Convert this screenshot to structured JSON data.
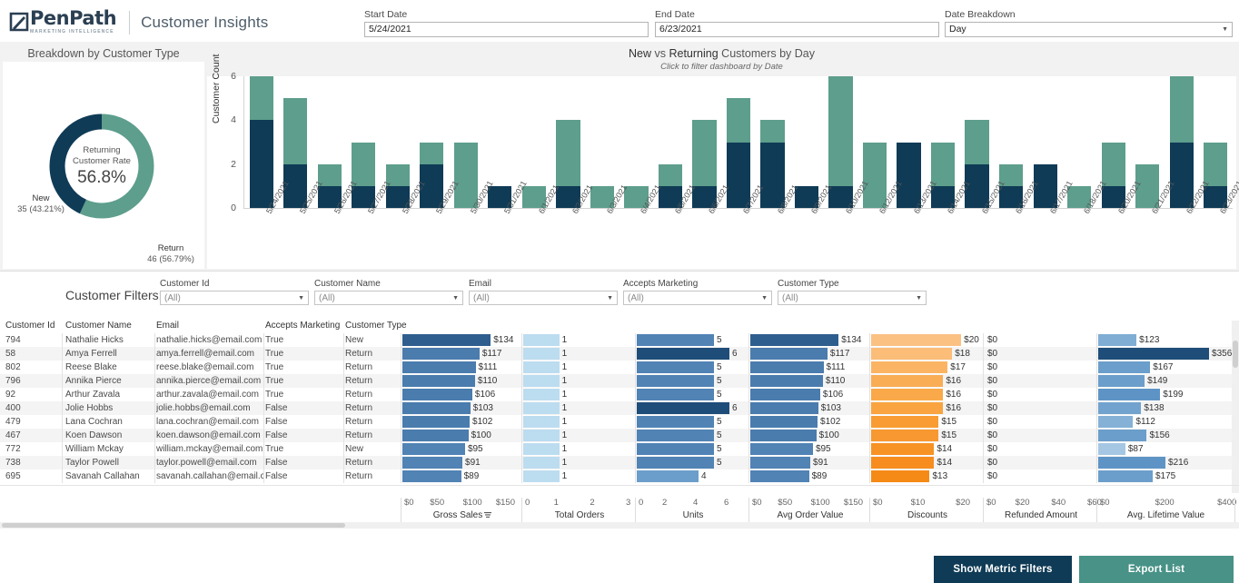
{
  "header": {
    "logo_name": "PenPath",
    "logo_sub": "MARKETING INTELLIGENCE",
    "app_title": "Customer Insights",
    "start_date": {
      "label": "Start Date",
      "value": "5/24/2021"
    },
    "end_date": {
      "label": "End Date",
      "value": "6/23/2021"
    },
    "date_breakdown": {
      "label": "Date Breakdown",
      "value": "Day"
    }
  },
  "donut_panel": {
    "title": "Breakdown by Customer Type",
    "center_line1": "Returning",
    "center_line2": "Customer Rate",
    "center_value": "56.8%",
    "new_label": "New",
    "new_value": "35 (43.21%)",
    "return_label": "Return",
    "return_value": "46 (56.79%)"
  },
  "bar_panel": {
    "title_a": "New",
    "title_b": "vs",
    "title_c": "Returning",
    "title_d": "Customers by Day",
    "subtitle": "Click to filter dashboard by Date"
  },
  "chart_data": {
    "type": "bar",
    "title": "New vs Returning Customers by Day",
    "subtitle": "Click to filter dashboard by Date",
    "xlabel": "",
    "ylabel": "Customer Count",
    "ylim": [
      0,
      6
    ],
    "yticks": [
      0,
      2,
      4,
      6
    ],
    "stacked": true,
    "grid": false,
    "legend_position": "none",
    "categories": [
      "5/24/2021",
      "5/25/2021",
      "5/26/2021",
      "5/27/2021",
      "5/28/2021",
      "5/29/2021",
      "5/30/2021",
      "5/31/2021",
      "6/1/2021",
      "6/2/2021",
      "6/3/2021",
      "6/4/2021",
      "6/5/2021",
      "6/6/2021",
      "6/7/2021",
      "6/8/2021",
      "6/9/2021",
      "6/10/2021",
      "6/12/2021",
      "6/13/2021",
      "6/14/2021",
      "6/15/2021",
      "6/16/2021",
      "6/17/2021",
      "6/18/2021",
      "6/20/2021",
      "6/21/2021",
      "6/22/2021",
      "6/23/2021"
    ],
    "series": [
      {
        "name": "New",
        "color": "#0f3b56",
        "values": [
          4,
          2,
          1,
          1,
          1,
          2,
          0,
          1,
          0,
          1,
          0,
          0,
          1,
          1,
          3,
          3,
          1,
          1,
          0,
          3,
          1,
          2,
          1,
          2,
          0,
          1,
          0,
          3,
          1
        ]
      },
      {
        "name": "Return",
        "color": "#5d9e8c",
        "values": [
          2,
          3,
          1,
          2,
          1,
          1,
          3,
          0,
          1,
          3,
          1,
          1,
          1,
          3,
          2,
          1,
          0,
          5,
          3,
          0,
          2,
          2,
          1,
          0,
          1,
          2,
          2,
          3,
          2
        ]
      }
    ]
  },
  "filters": {
    "title": "Customer Filters:",
    "items": [
      {
        "label": "Customer Id",
        "value": "(All)"
      },
      {
        "label": "Customer Name",
        "value": "(All)"
      },
      {
        "label": "Email",
        "value": "(All)"
      },
      {
        "label": "Accepts Marketing",
        "value": "(All)"
      },
      {
        "label": "Customer Type",
        "value": "(All)"
      }
    ],
    "show_metric_filters": "Show Metric Filters",
    "export_list": "Export List"
  },
  "table": {
    "text_headers": [
      "Customer Id",
      "Customer Name",
      "Email",
      "Accepts Marketing",
      "Customer Type"
    ],
    "metric_axes": [
      {
        "name": "Gross Sales",
        "ticks": [
          "$0",
          "$50",
          "$100",
          "$150"
        ],
        "max": 175,
        "sorted": true
      },
      {
        "name": "Total Orders",
        "ticks": [
          "0",
          "1",
          "2",
          "3"
        ],
        "max": 3,
        "sorted": false
      },
      {
        "name": "Units",
        "ticks": [
          "0",
          "2",
          "4",
          "6"
        ],
        "max": 7,
        "sorted": false
      },
      {
        "name": "Avg Order Value",
        "ticks": [
          "$0",
          "$50",
          "$100",
          "$150"
        ],
        "max": 175,
        "sorted": false
      },
      {
        "name": "Discounts",
        "ticks": [
          "$0",
          "$10",
          "$20"
        ],
        "max": 24,
        "sorted": false
      },
      {
        "name": "Refunded Amount",
        "ticks": [
          "$0",
          "$20",
          "$40",
          "$60"
        ],
        "max": 60,
        "sorted": false
      },
      {
        "name": "Avg. Lifetime Value",
        "ticks": [
          "$0",
          "$200",
          "$400"
        ],
        "max": 420,
        "sorted": false
      }
    ],
    "rows": [
      {
        "id": "794",
        "name": "Nathalie Hicks",
        "email": "nathalie.hicks@email.com",
        "marketing": "True",
        "type": "New",
        "gross_sales": "$134",
        "gross_sales_v": 134,
        "gross_sales_color": "#2e5e8e",
        "orders": "1",
        "orders_v": 1,
        "orders_color": "#bcdcf0",
        "units": "5",
        "units_v": 5,
        "units_color": "#5183b5",
        "aov": "$134",
        "aov_v": 134,
        "aov_color": "#2e5e8e",
        "discounts": "$20",
        "discounts_v": 20,
        "discounts_color": "#fbc183",
        "refunded": "$0",
        "refunded_v": 0,
        "ltv": "$123",
        "ltv_v": 123,
        "ltv_color": "#7fadd4"
      },
      {
        "id": "58",
        "name": "Amya Ferrell",
        "email": "amya.ferrell@email.com",
        "marketing": "True",
        "type": "Return",
        "gross_sales": "$117",
        "gross_sales_v": 117,
        "gross_sales_color": "#4a7cae",
        "orders": "1",
        "orders_v": 1,
        "orders_color": "#bcdcf0",
        "units": "6",
        "units_v": 6,
        "units_color": "#1f4d79",
        "aov": "$117",
        "aov_v": 117,
        "aov_color": "#4a7cae",
        "discounts": "$18",
        "discounts_v": 18,
        "discounts_color": "#fbbd78",
        "refunded": "$0",
        "refunded_v": 0,
        "ltv": "$356",
        "ltv_v": 356,
        "ltv_color": "#1f4d79"
      },
      {
        "id": "802",
        "name": "Reese Blake",
        "email": "reese.blake@email.com",
        "marketing": "True",
        "type": "Return",
        "gross_sales": "$111",
        "gross_sales_v": 111,
        "gross_sales_color": "#4a7cae",
        "orders": "1",
        "orders_v": 1,
        "orders_color": "#bcdcf0",
        "units": "5",
        "units_v": 5,
        "units_color": "#5183b5",
        "aov": "$111",
        "aov_v": 111,
        "aov_color": "#4a7cae",
        "discounts": "$17",
        "discounts_v": 17,
        "discounts_color": "#fbb463",
        "refunded": "$0",
        "refunded_v": 0,
        "ltv": "$167",
        "ltv_v": 167,
        "ltv_color": "#6b9ecb"
      },
      {
        "id": "796",
        "name": "Annika Pierce",
        "email": "annika.pierce@email.com",
        "marketing": "True",
        "type": "Return",
        "gross_sales": "$110",
        "gross_sales_v": 110,
        "gross_sales_color": "#4a7cae",
        "orders": "1",
        "orders_v": 1,
        "orders_color": "#bcdcf0",
        "units": "5",
        "units_v": 5,
        "units_color": "#5183b5",
        "aov": "$110",
        "aov_v": 110,
        "aov_color": "#4a7cae",
        "discounts": "$16",
        "discounts_v": 16,
        "discounts_color": "#f9ad55",
        "refunded": "$0",
        "refunded_v": 0,
        "ltv": "$149",
        "ltv_v": 149,
        "ltv_color": "#6b9ecb"
      },
      {
        "id": "92",
        "name": "Arthur Zavala",
        "email": "arthur.zavala@email.com",
        "marketing": "True",
        "type": "Return",
        "gross_sales": "$106",
        "gross_sales_v": 106,
        "gross_sales_color": "#4a7cae",
        "orders": "1",
        "orders_v": 1,
        "orders_color": "#bcdcf0",
        "units": "5",
        "units_v": 5,
        "units_color": "#5183b5",
        "aov": "$106",
        "aov_v": 106,
        "aov_color": "#4a7cae",
        "discounts": "$16",
        "discounts_v": 16,
        "discounts_color": "#f9a949",
        "refunded": "$0",
        "refunded_v": 0,
        "ltv": "$199",
        "ltv_v": 199,
        "ltv_color": "#5e94c5"
      },
      {
        "id": "400",
        "name": "Jolie Hobbs",
        "email": "jolie.hobbs@email.com",
        "marketing": "False",
        "type": "Return",
        "gross_sales": "$103",
        "gross_sales_v": 103,
        "gross_sales_color": "#4a7cae",
        "orders": "1",
        "orders_v": 1,
        "orders_color": "#bcdcf0",
        "units": "6",
        "units_v": 6,
        "units_color": "#1f4d79",
        "aov": "$103",
        "aov_v": 103,
        "aov_color": "#4a7cae",
        "discounts": "$16",
        "discounts_v": 16,
        "discounts_color": "#f9a440",
        "refunded": "$0",
        "refunded_v": 0,
        "ltv": "$138",
        "ltv_v": 138,
        "ltv_color": "#72a3ce"
      },
      {
        "id": "479",
        "name": "Lana Cochran",
        "email": "lana.cochran@email.com",
        "marketing": "False",
        "type": "Return",
        "gross_sales": "$102",
        "gross_sales_v": 102,
        "gross_sales_color": "#4a7cae",
        "orders": "1",
        "orders_v": 1,
        "orders_color": "#bcdcf0",
        "units": "5",
        "units_v": 5,
        "units_color": "#5183b5",
        "aov": "$102",
        "aov_v": 102,
        "aov_color": "#4a7cae",
        "discounts": "$15",
        "discounts_v": 15,
        "discounts_color": "#f89c33",
        "refunded": "$0",
        "refunded_v": 0,
        "ltv": "$112",
        "ltv_v": 112,
        "ltv_color": "#85b1d6"
      },
      {
        "id": "467",
        "name": "Koen Dawson",
        "email": "koen.dawson@email.com",
        "marketing": "False",
        "type": "Return",
        "gross_sales": "$100",
        "gross_sales_v": 100,
        "gross_sales_color": "#4a7cae",
        "orders": "1",
        "orders_v": 1,
        "orders_color": "#bcdcf0",
        "units": "5",
        "units_v": 5,
        "units_color": "#5183b5",
        "aov": "$100",
        "aov_v": 100,
        "aov_color": "#4a7cae",
        "discounts": "$15",
        "discounts_v": 15,
        "discounts_color": "#f89830",
        "refunded": "$0",
        "refunded_v": 0,
        "ltv": "$156",
        "ltv_v": 156,
        "ltv_color": "#6b9ecb"
      },
      {
        "id": "772",
        "name": "William Mckay",
        "email": "william.mckay@email.com",
        "marketing": "True",
        "type": "New",
        "gross_sales": "$95",
        "gross_sales_v": 95,
        "gross_sales_color": "#5183b5",
        "orders": "1",
        "orders_v": 1,
        "orders_color": "#bcdcf0",
        "units": "5",
        "units_v": 5,
        "units_color": "#5183b5",
        "aov": "$95",
        "aov_v": 95,
        "aov_color": "#5183b5",
        "discounts": "$14",
        "discounts_v": 14,
        "discounts_color": "#f79224",
        "refunded": "$0",
        "refunded_v": 0,
        "ltv": "$87",
        "ltv_v": 87,
        "ltv_color": "#a5c7e4"
      },
      {
        "id": "738",
        "name": "Taylor Powell",
        "email": "taylor.powell@email.com",
        "marketing": "False",
        "type": "Return",
        "gross_sales": "$91",
        "gross_sales_v": 91,
        "gross_sales_color": "#5183b5",
        "orders": "1",
        "orders_v": 1,
        "orders_color": "#bcdcf0",
        "units": "5",
        "units_v": 5,
        "units_color": "#5183b5",
        "aov": "$91",
        "aov_v": 91,
        "aov_color": "#5183b5",
        "discounts": "$14",
        "discounts_v": 14,
        "discounts_color": "#f78d1e",
        "refunded": "$0",
        "refunded_v": 0,
        "ltv": "$216",
        "ltv_v": 216,
        "ltv_color": "#5e94c5"
      },
      {
        "id": "695",
        "name": "Savanah Callahan",
        "email": "savanah.callahan@email.c..",
        "marketing": "False",
        "type": "Return",
        "gross_sales": "$89",
        "gross_sales_v": 89,
        "gross_sales_color": "#5183b5",
        "orders": "1",
        "orders_v": 1,
        "orders_color": "#bcdcf0",
        "units": "4",
        "units_v": 4,
        "units_color": "#6b9ecb",
        "aov": "$89",
        "aov_v": 89,
        "aov_color": "#5183b5",
        "discounts": "$13",
        "discounts_v": 13,
        "discounts_color": "#f68a17",
        "refunded": "$0",
        "refunded_v": 0,
        "ltv": "$175",
        "ltv_v": 175,
        "ltv_color": "#6b9ecb"
      }
    ]
  }
}
